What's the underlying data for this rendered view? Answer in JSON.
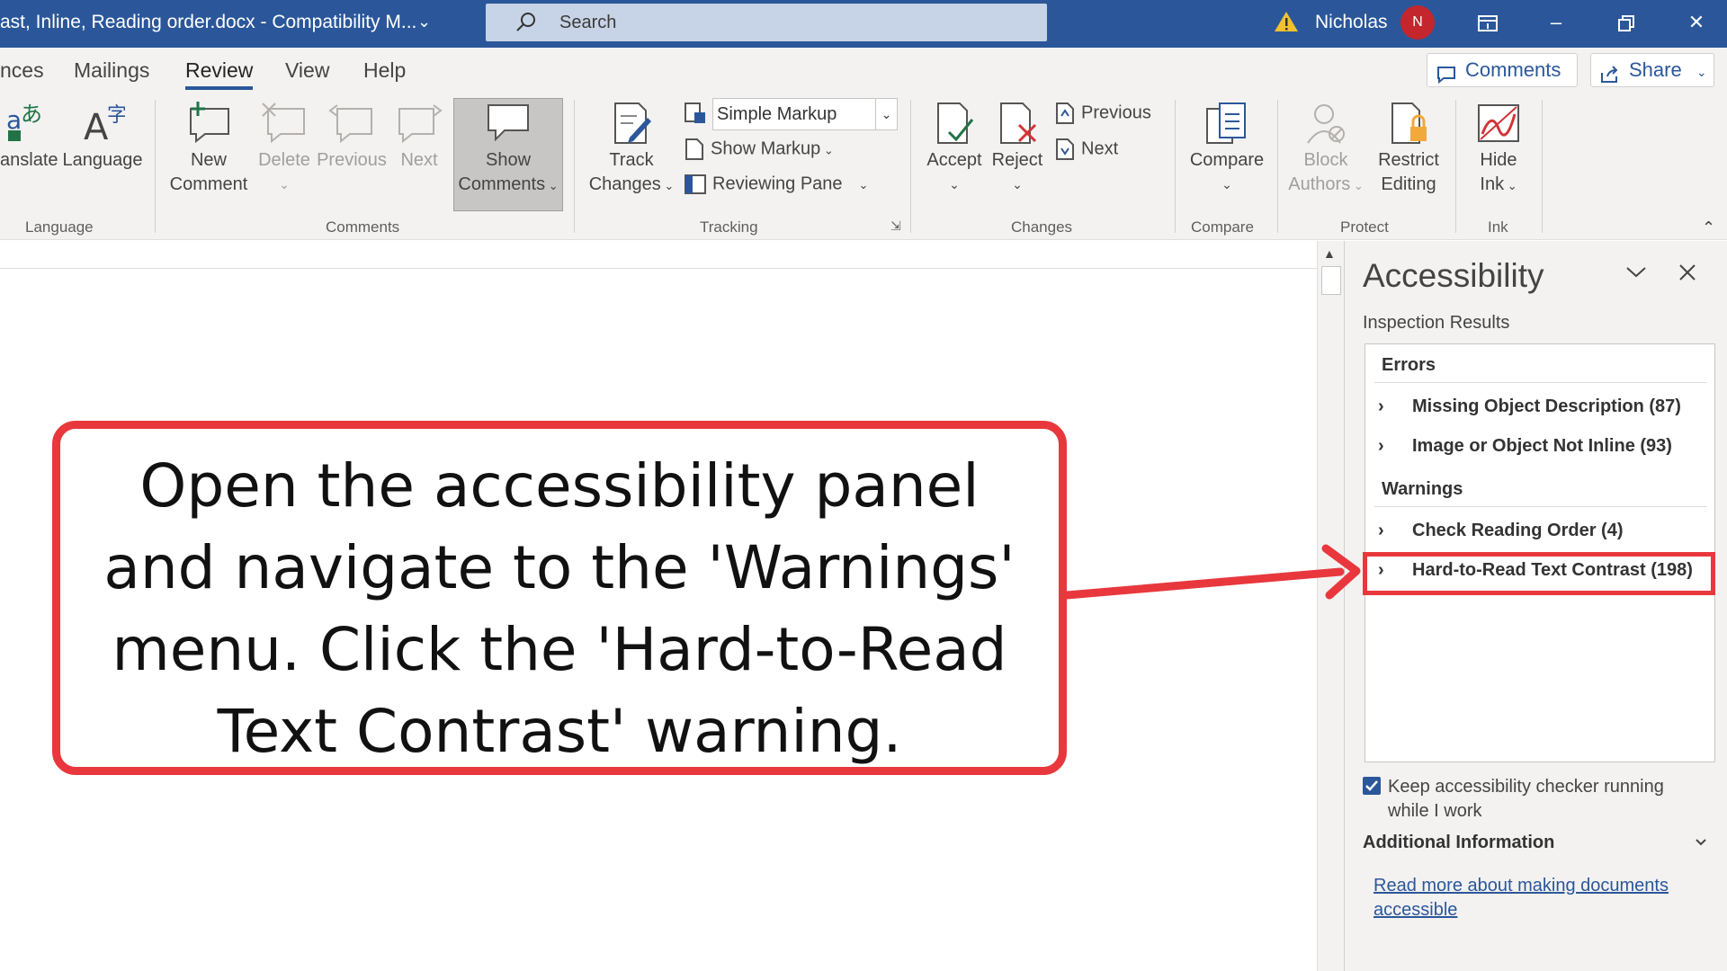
{
  "titlebar": {
    "doc_title": "ast, Inline, Reading order.docx  -  Compatibility M...",
    "search_placeholder": "Search",
    "user_name": "Nicholas",
    "avatar_initial": "N",
    "icons": [
      "warning-icon",
      "ribbon-display-icon",
      "minimize-icon",
      "restore-icon",
      "close-icon"
    ]
  },
  "ribbon_tabs": {
    "tabs": [
      "nces",
      "Mailings",
      "Review",
      "View",
      "Help"
    ],
    "active": "Review",
    "comments_btn": "Comments",
    "share_btn": "Share"
  },
  "ribbon": {
    "language_group": {
      "translate": "anslate",
      "language": "Language",
      "label": "Language"
    },
    "comments_group": {
      "new_comment_line1": "New",
      "new_comment_line2": "Comment",
      "delete": "Delete",
      "previous": "Previous",
      "next": "Next",
      "show_comments_line1": "Show",
      "show_comments_line2": "Comments",
      "label": "Comments"
    },
    "tracking_group": {
      "track_line1": "Track",
      "track_line2": "Changes",
      "markup_value": "Simple Markup",
      "show_markup": "Show Markup",
      "reviewing_pane": "Reviewing Pane",
      "label": "Tracking"
    },
    "changes_group": {
      "accept": "Accept",
      "reject": "Reject",
      "previous": "Previous",
      "next": "Next",
      "label": "Changes"
    },
    "compare_group": {
      "compare": "Compare",
      "label": "Compare"
    },
    "protect_group": {
      "block_line1": "Block",
      "block_line2": "Authors",
      "restrict_line1": "Restrict",
      "restrict_line2": "Editing",
      "label": "Protect"
    },
    "ink_group": {
      "hide_line1": "Hide",
      "hide_line2": "Ink",
      "label": "Ink"
    }
  },
  "pane": {
    "title": "Accessibility",
    "subheading": "Inspection Results",
    "errors_label": "Errors",
    "errors": [
      "Missing Object Description (87)",
      "Image or Object Not Inline (93)"
    ],
    "warnings_label": "Warnings",
    "warnings": [
      "Check Reading Order (4)",
      "Hard-to-Read Text Contrast (198)"
    ],
    "keep_running": "Keep accessibility checker running while I work",
    "keep_running_checked": true,
    "additional_info": "Additional Information",
    "read_more": "Read more about making documents accessible"
  },
  "callout": {
    "text": "Open the accessibility panel and navigate to the 'Warnings' menu. Click the 'Hard-to-Read Text Contrast' warning.",
    "border_color": "#e8383d"
  },
  "colors": {
    "titlebar": "#2b579a",
    "ribbon": "#f3f2f1",
    "accent": "#2b579a",
    "annotation_red": "#e8383d"
  }
}
